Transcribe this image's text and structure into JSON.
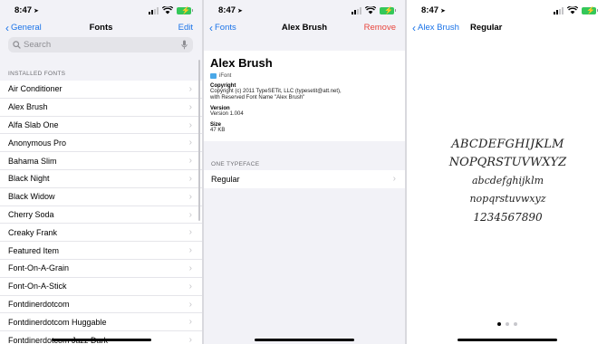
{
  "status": {
    "time": "8:47"
  },
  "panel1": {
    "nav": {
      "back": "General",
      "title": "Fonts",
      "action": "Edit"
    },
    "search": {
      "placeholder": "Search"
    },
    "section": "INSTALLED FONTS",
    "fonts": [
      "Air Conditioner",
      "Alex Brush",
      "Alfa Slab One",
      "Anonymous Pro",
      "Bahama Slim",
      "Black Night",
      "Black Widow",
      "Cherry Soda",
      "Creaky Frank",
      "Featured Item",
      "Font-On-A-Grain",
      "Font-On-A-Stick",
      "Fontdinerdotcom",
      "Fontdinerdotcom Huggable",
      "Fontdinerdotcom Jazz Dark"
    ]
  },
  "panel2": {
    "nav": {
      "back": "Fonts",
      "title": "Alex Brush",
      "action": "Remove"
    },
    "font_name": "Alex Brush",
    "source": "iFont",
    "copyright_label": "Copyright",
    "copyright_line1": "Copyright (c) 2011 TypeSETit, LLC (typesetit@att.net),",
    "copyright_line2": "with Reserved Font Name \"Alex Brush\"",
    "version_label": "Version",
    "version": "Version 1.004",
    "size_label": "Size",
    "size": "47 KB",
    "typeface_header": "ONE TYPEFACE",
    "typeface": "Regular"
  },
  "panel3": {
    "nav": {
      "back": "Alex Brush",
      "title": "Regular"
    },
    "sample_lines": [
      "ABCDEFGHIJKLM",
      "NOPQRSTUVWXYZ",
      "abcdefghijklm",
      "nopqrstuvwxyz",
      "1234567890"
    ],
    "page_count": 3,
    "current_page": 1
  }
}
